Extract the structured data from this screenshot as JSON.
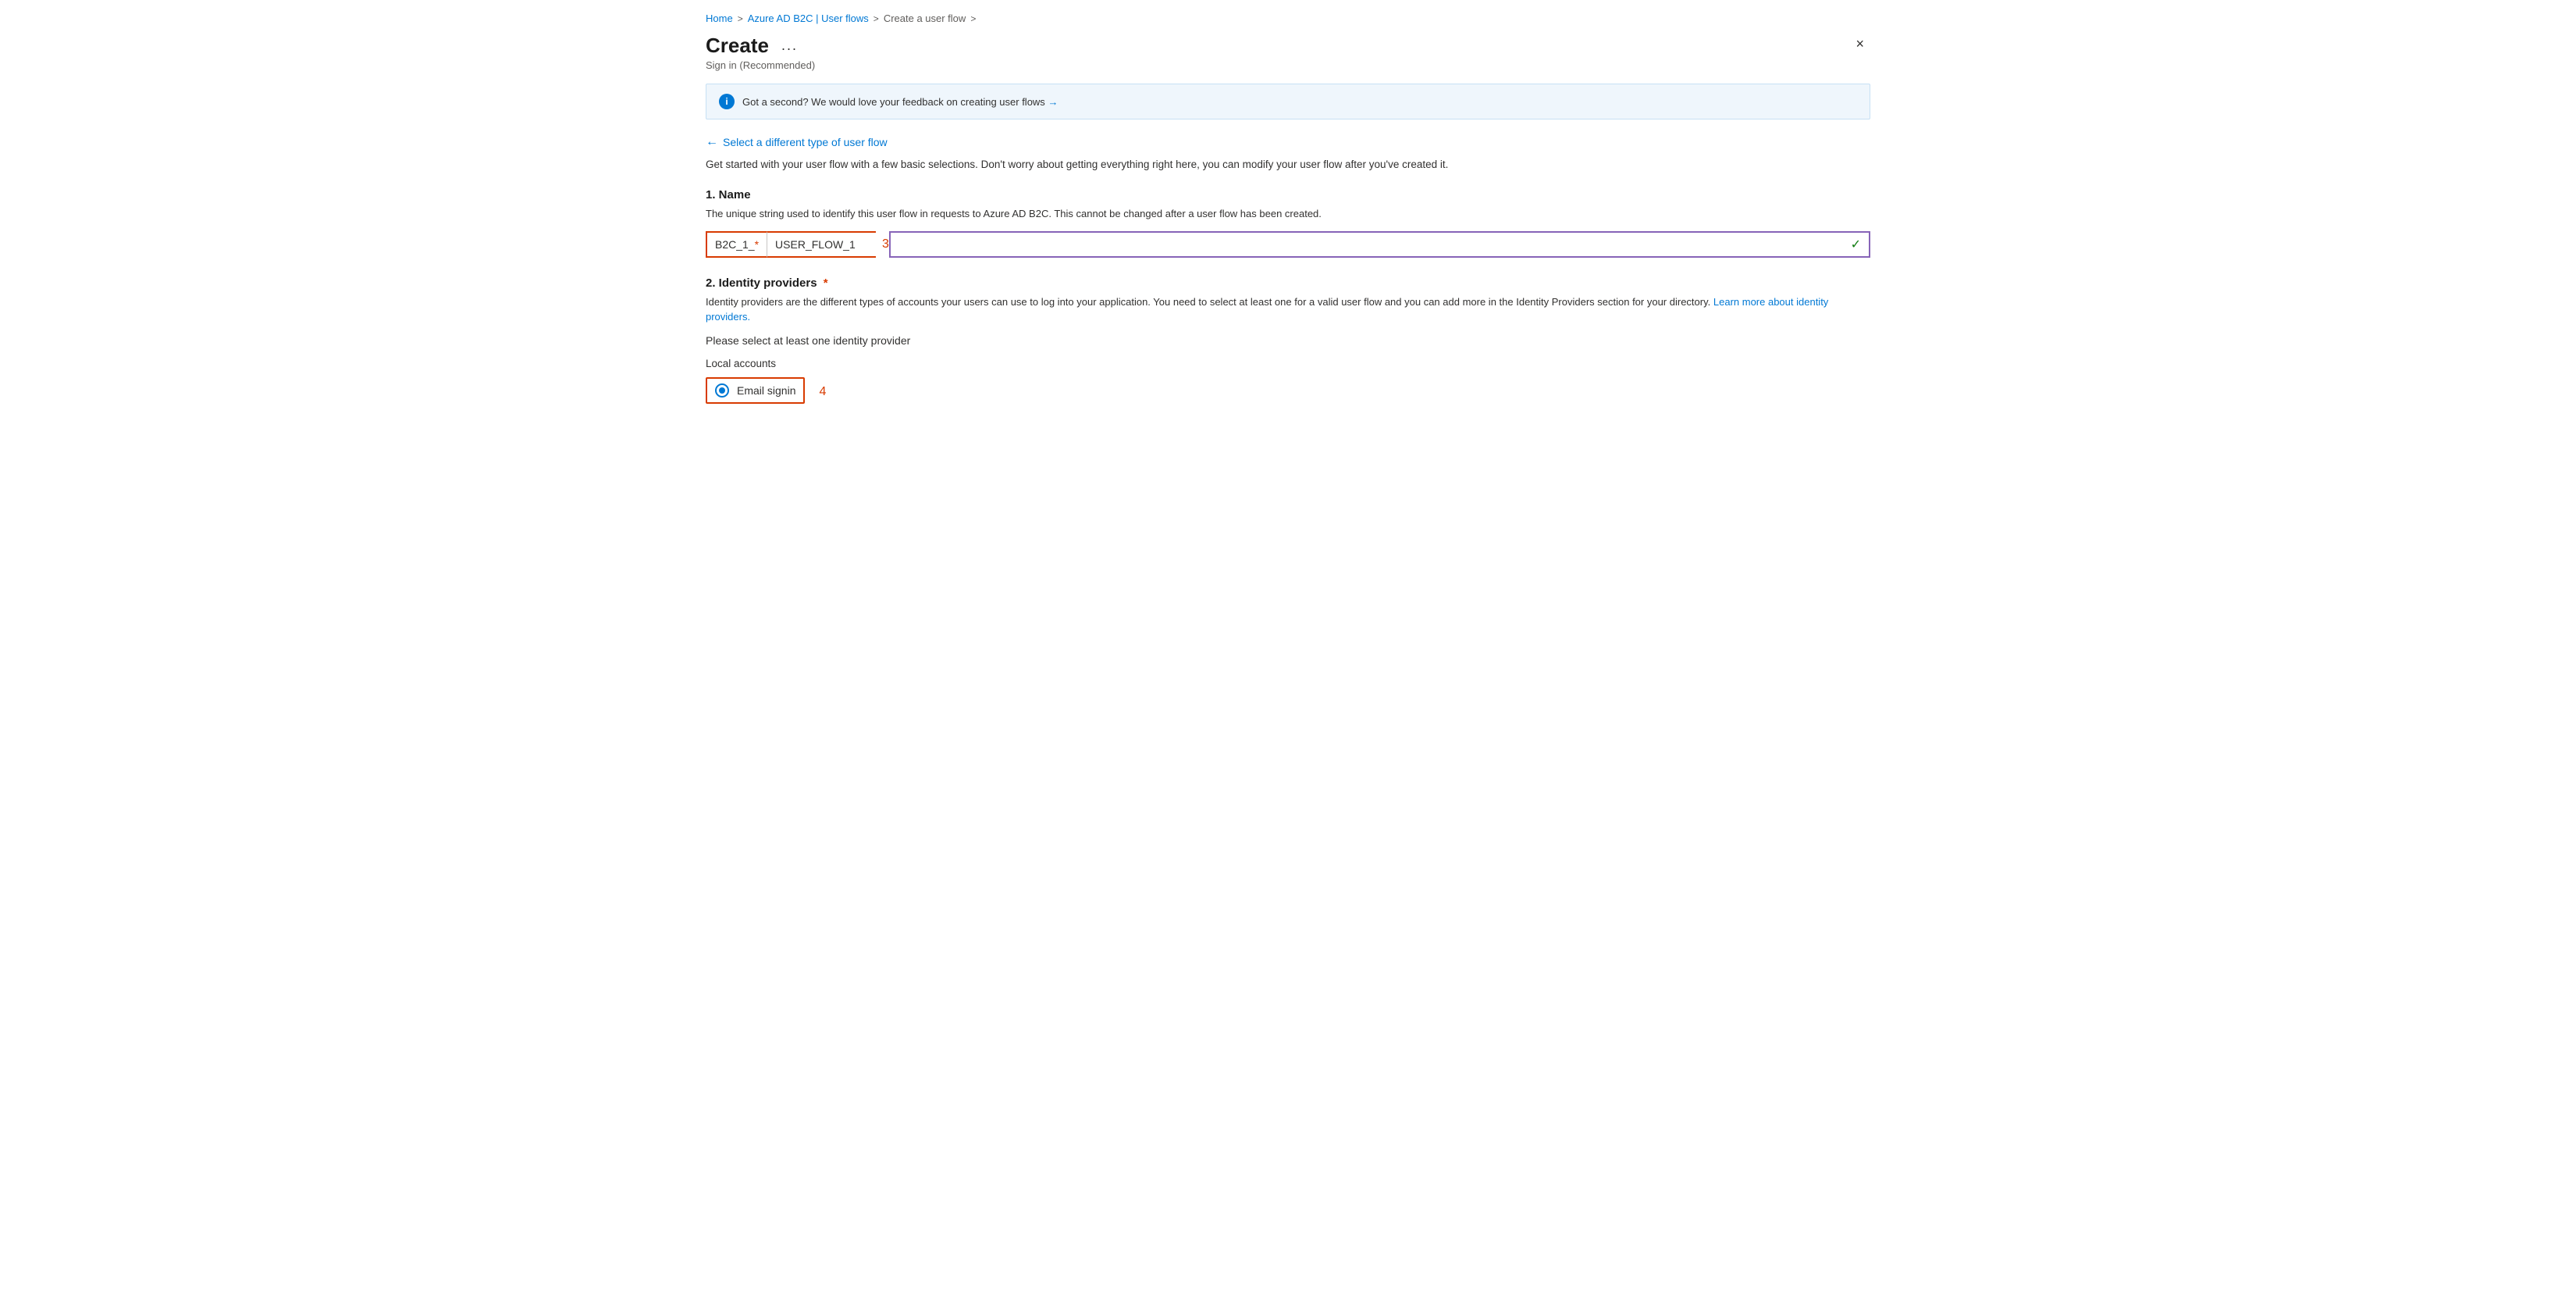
{
  "breadcrumb": {
    "items": [
      {
        "label": "Home",
        "href": "#"
      },
      {
        "label": "Azure AD B2C | User flows",
        "href": "#"
      },
      {
        "label": "Create a user flow",
        "href": "#"
      }
    ],
    "separators": [
      ">",
      ">",
      ">"
    ]
  },
  "header": {
    "title": "Create",
    "ellipsis": "...",
    "subtitle": "Sign in (Recommended)",
    "close_label": "×"
  },
  "info_banner": {
    "text": "Got a second? We would love your feedback on creating user flows",
    "arrow": "→"
  },
  "select_link": {
    "arrow": "←",
    "label": "Select a different type of user flow"
  },
  "description": "Get started with your user flow with a few basic selections. Don't worry about getting everything right here, you can modify your user flow after you've created it.",
  "section_name": {
    "title": "1. Name",
    "description": "The unique string used to identify this user flow in requests to Azure AD B2C. This cannot be changed after a user flow has been created.",
    "prefix_label": "B2C_1_",
    "required_star": "*",
    "input_value": "USER_FLOW_1",
    "annotation_number": "3",
    "full_input_placeholder": ""
  },
  "section_identity": {
    "title": "2. Identity providers",
    "required_star": "*",
    "description_part1": "Identity providers are the different types of accounts your users can use to log into your application. You need to select at least one for a valid user flow and you can add more in the Identity Providers section for your directory.",
    "learn_more_label": "Learn more about identity providers.",
    "learn_more_href": "#",
    "select_text": "Please select at least one identity provider",
    "local_accounts_label": "Local accounts",
    "email_signin_label": "Email signin",
    "annotation_number": "4"
  }
}
